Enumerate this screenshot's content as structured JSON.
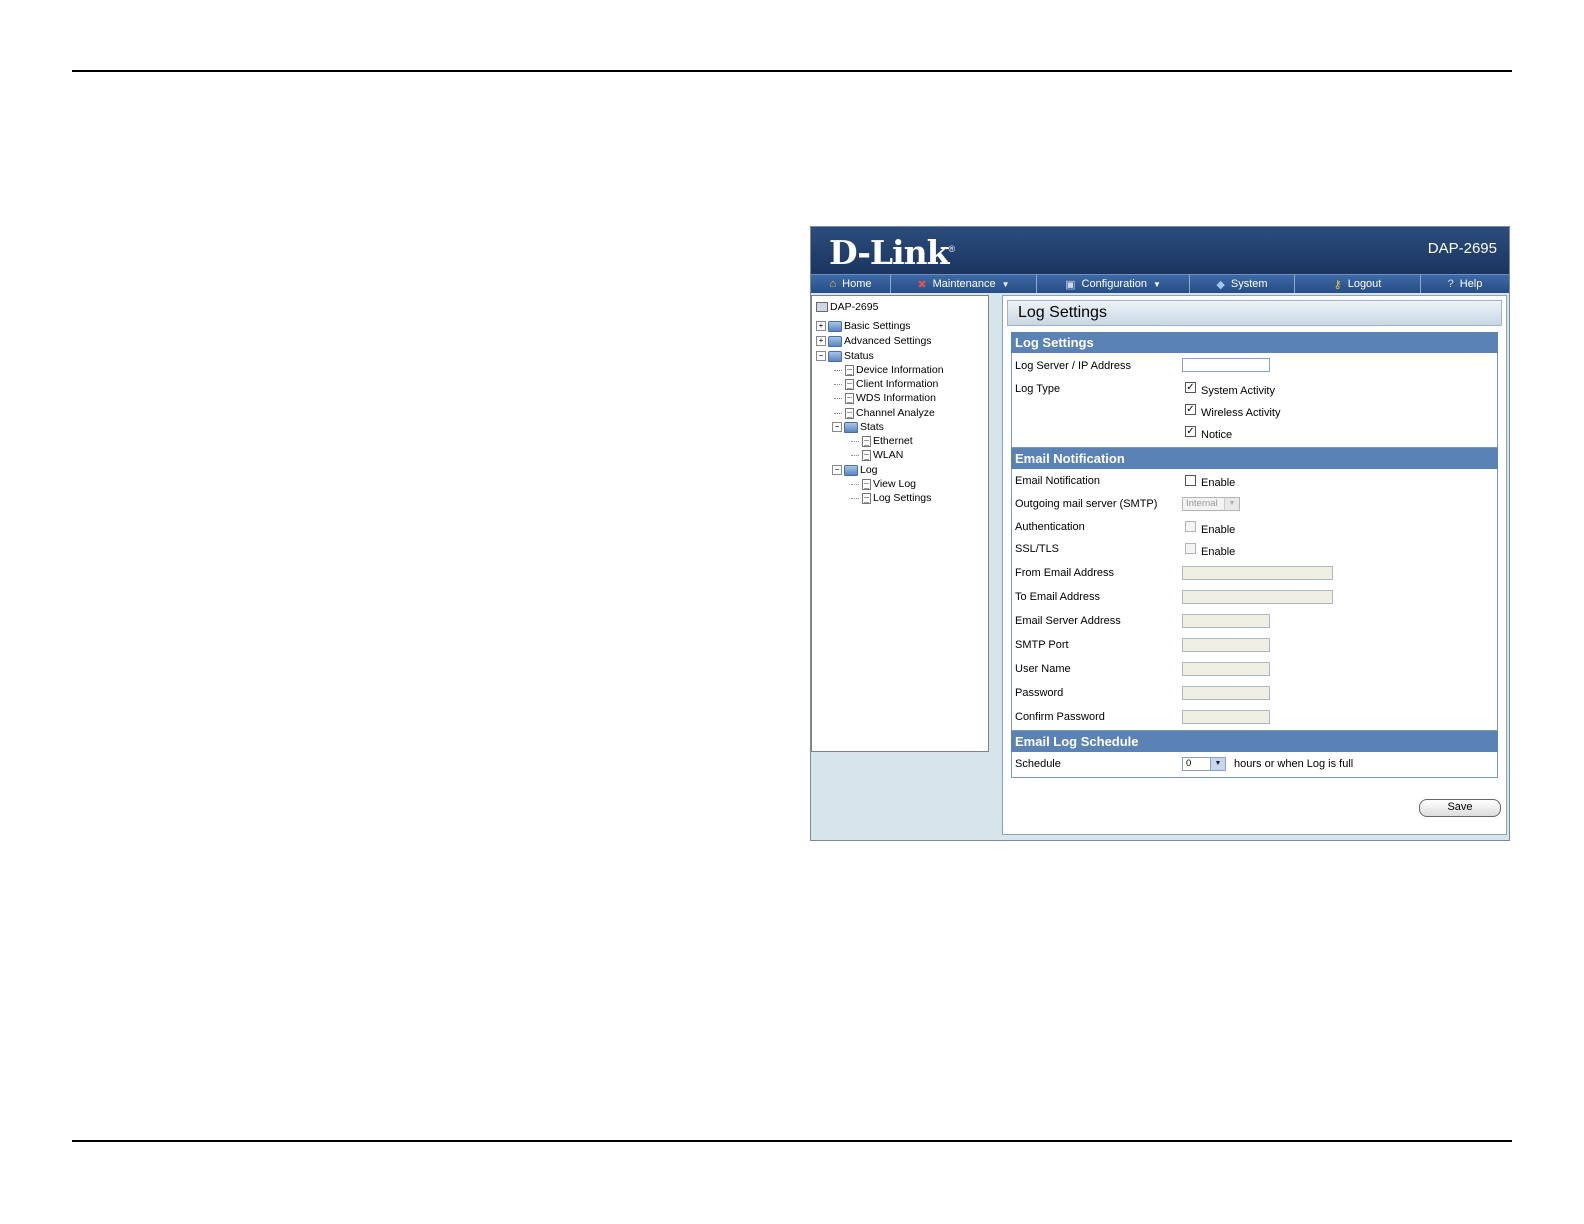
{
  "header": {
    "brand": "D-Link",
    "brand_mark": "®",
    "model": "DAP-2695"
  },
  "nav": [
    {
      "label": "Home",
      "icon": "home-icon"
    },
    {
      "label": "Maintenance",
      "icon": "tools-icon",
      "dropdown": true
    },
    {
      "label": "Configuration",
      "icon": "disk-icon",
      "dropdown": true
    },
    {
      "label": "System",
      "icon": "system-icon"
    },
    {
      "label": "Logout",
      "icon": "key-icon"
    },
    {
      "label": "Help",
      "icon": "help-icon"
    }
  ],
  "tree": {
    "root": "DAP-2695",
    "basic": "Basic Settings",
    "advanced": "Advanced Settings",
    "status": "Status",
    "device_info": "Device Information",
    "client_info": "Client Information",
    "wds_info": "WDS Information",
    "channel_analyze": "Channel Analyze",
    "stats": "Stats",
    "ethernet": "Ethernet",
    "wlan": "WLAN",
    "log": "Log",
    "view_log": "View Log",
    "log_settings": "Log Settings"
  },
  "page": {
    "title": "Log Settings",
    "log_section": {
      "title": "Log Settings",
      "server_label": "Log Server / IP Address",
      "server_value": "",
      "type_label": "Log Type",
      "system_activity": "System Activity",
      "wireless_activity": "Wireless Activity",
      "notice": "Notice"
    },
    "email_section": {
      "title": "Email Notification",
      "notification_label": "Email Notification",
      "notification_enable": "Enable",
      "smtp_label": "Outgoing mail server (SMTP)",
      "smtp_value": "Internal",
      "auth_label": "Authentication",
      "auth_enable": "Enable",
      "ssl_label": "SSL/TLS",
      "ssl_enable": "Enable",
      "from_label": "From Email Address",
      "to_label": "To Email Address",
      "server_label": "Email Server Address",
      "port_label": "SMTP Port",
      "user_label": "User Name",
      "password_label": "Password",
      "confirm_label": "Confirm Password"
    },
    "schedule_section": {
      "title": "Email Log Schedule",
      "schedule_label": "Schedule",
      "schedule_value": "0",
      "schedule_suffix": "hours or when Log is full"
    },
    "save_label": "Save"
  },
  "colors": {
    "header": "#1b3560",
    "nav": "#264d86",
    "section": "#5b82b4",
    "frame": "#d6e4ec"
  }
}
